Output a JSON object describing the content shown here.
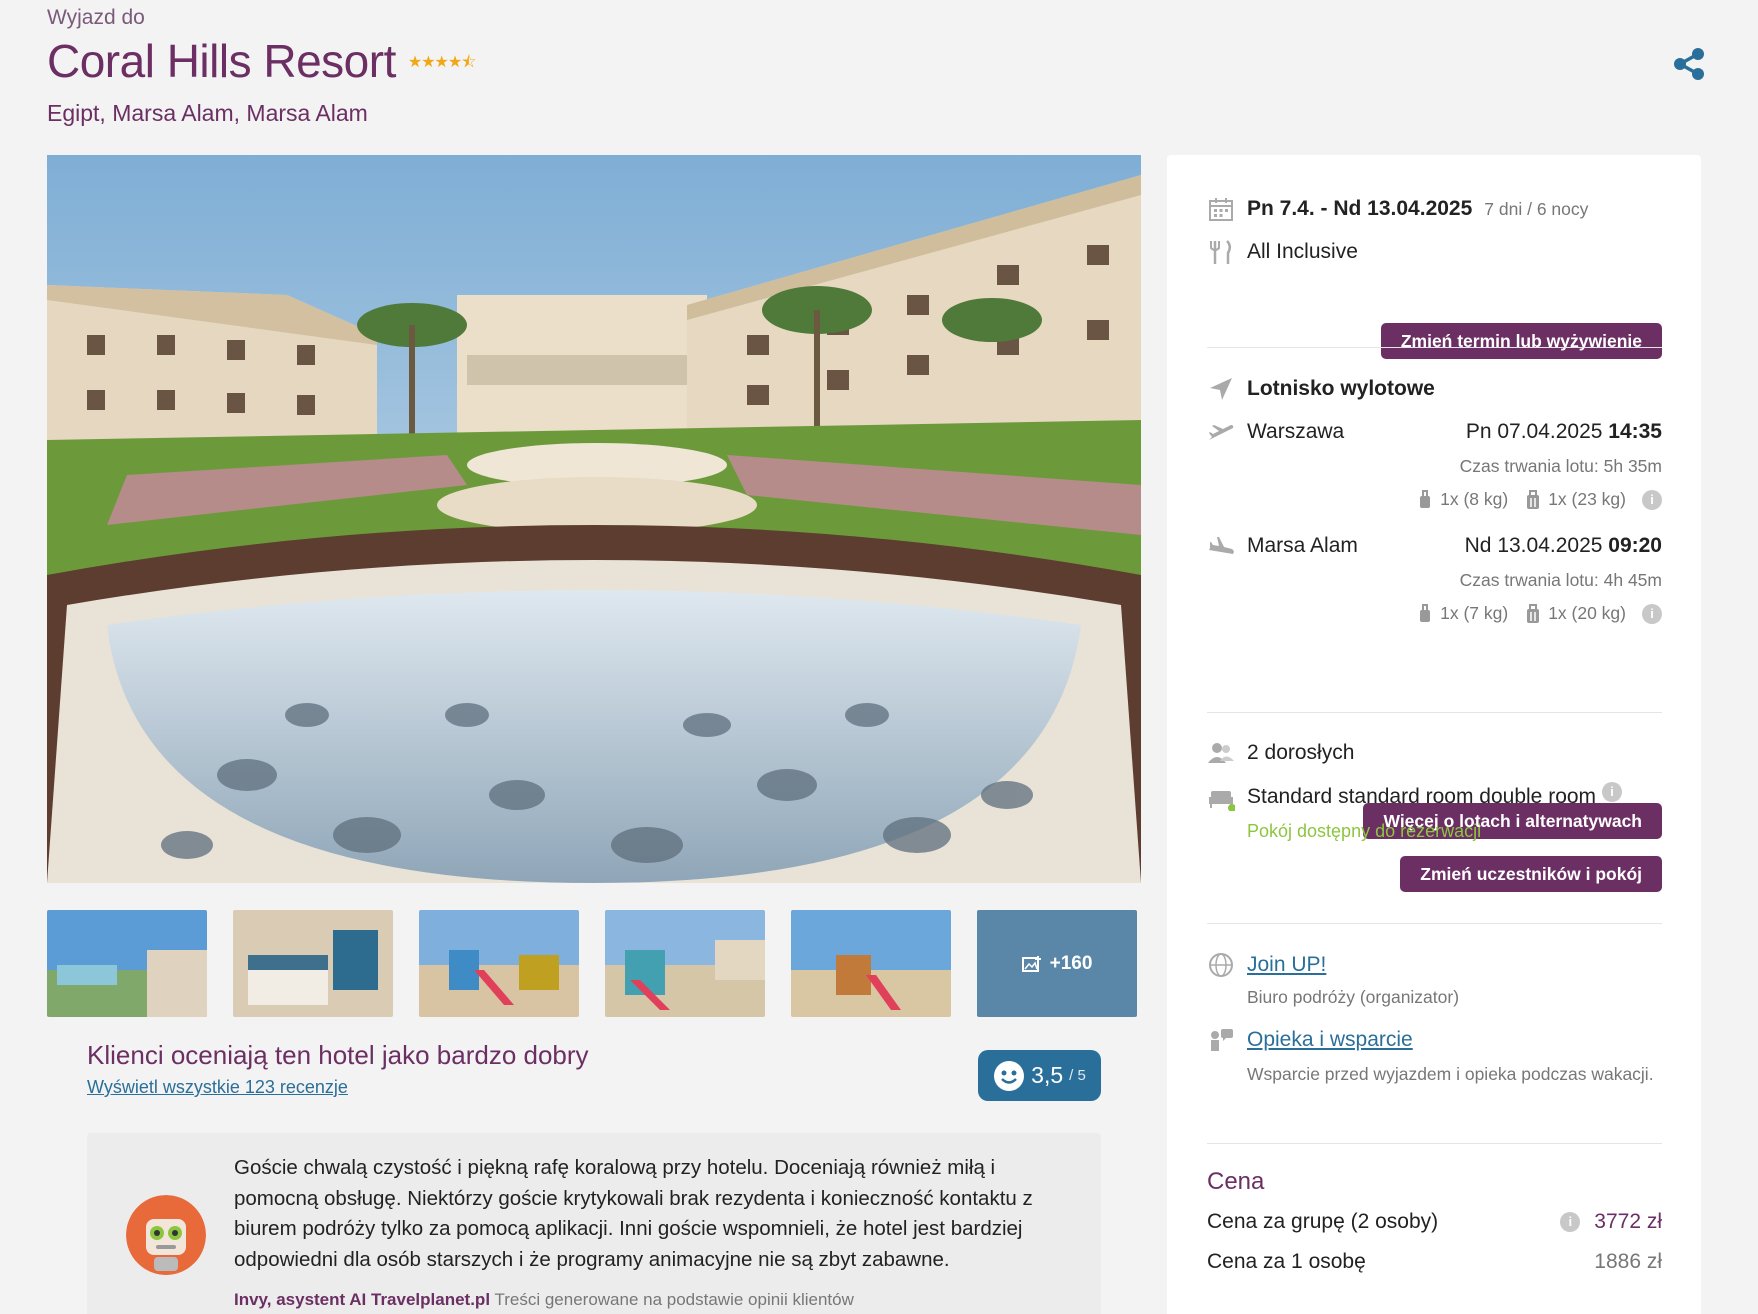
{
  "header": {
    "pre_title": "Wyjazd do",
    "hotel_name": "Coral Hills Resort",
    "stars_rating": 4.5,
    "stars_glyph": "★★★★⯪",
    "location": "Egipt, Marsa Alam, Marsa Alam"
  },
  "gallery": {
    "more_count": "+160"
  },
  "reviews": {
    "title": "Klienci oceniają ten hotel jako bardzo dobry",
    "link": "Wyświetl wszystkie 123 recenzje",
    "score": "3,5",
    "score_max": "/ 5"
  },
  "ai_summary": {
    "text": "Goście chwalą czystość i piękną rafę koralową przy hotelu. Doceniają również miłą i pomocną obsługę. Niektórzy goście krytykowali brak rezydenta i konieczność kontaktu z biurem podróży tylko za pomocą aplikacji. Inni goście wspomnieli, że hotel jest bardziej odpowiedni dla osób starszych i że programy animacyjne nie są zbyt zabawne.",
    "author": "Invy, asystent AI Travelplanet.pl",
    "note": "Treści generowane na podstawie opinii klientów"
  },
  "panel": {
    "dates": "Pn 7.4. - Nd 13.04.2025",
    "duration": "7 dni / 6 nocy",
    "board": "All Inclusive",
    "change_term_button": "Zmień termin lub wyżywienie",
    "airport_label": "Lotnisko wylotowe",
    "outbound": {
      "city": "Warszawa",
      "date": "Pn 07.04.2025",
      "time": "14:35",
      "duration": "Czas trwania lotu: 5h 35m",
      "hand_luggage": "1x (8 kg)",
      "checked_luggage": "1x (23 kg)"
    },
    "inbound": {
      "city": "Marsa Alam",
      "date": "Nd 13.04.2025",
      "time": "09:20",
      "duration": "Czas trwania lotu: 4h 45m",
      "hand_luggage": "1x (7 kg)",
      "checked_luggage": "1x (20 kg)"
    },
    "flights_button": "Więcej o lotach i alternatywach",
    "participants": "2 dorosłych",
    "room": "Standard standard room double room",
    "room_status": "Pokój dostępny do rezerwacji",
    "change_participants_button": "Zmień uczestników i pokój",
    "organizer_name": "Join UP!",
    "organizer_role": "Biuro podróży (organizator)",
    "support_link": "Opieka i wsparcie",
    "support_desc": "Wsparcie przed wyjazdem i opieka podczas wakacji.",
    "price_heading": "Cena",
    "price_group_label": "Cena za grupę (2 osoby)",
    "price_group_value": "3772 zł",
    "price_person_label": "Cena za 1 osobę",
    "price_person_value": "1886 zł"
  },
  "colors": {
    "brand_purple": "#6b2f63",
    "link_blue": "#2a6f9a",
    "available_green": "#8cc63f",
    "star_gold": "#f0a818"
  }
}
